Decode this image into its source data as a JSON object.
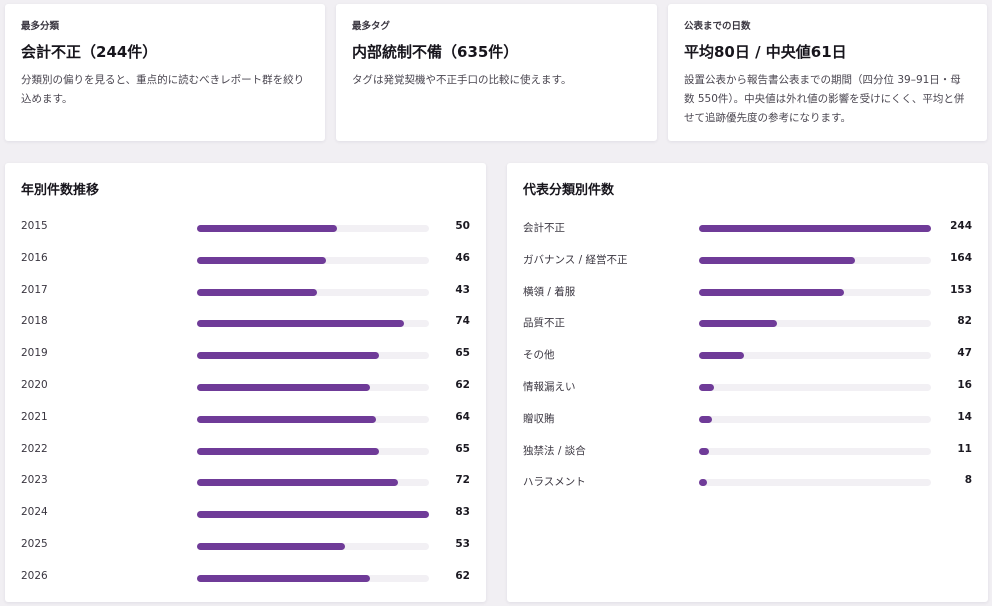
{
  "stats": [
    {
      "eyebrow": "最多分類",
      "value": "会計不正（244件）",
      "desc": "分類別の偏りを見ると、重点的に読むべきレポート群を絞り込めます。"
    },
    {
      "eyebrow": "最多タグ",
      "value": "内部統制不備（635件）",
      "desc": "タグは発覚契機や不正手口の比較に使えます。"
    },
    {
      "eyebrow": "公表までの日数",
      "value": "平均80日 / 中央値61日",
      "desc": "設置公表から報告書公表までの期間（四分位 39–91日・母数 550件）。中央値は外れ値の影響を受けにくく、平均と併せて追跡優先度の参考になります。"
    }
  ],
  "chart_data": [
    {
      "type": "bar",
      "title": "年別件数推移",
      "categories": [
        "2015",
        "2016",
        "2017",
        "2018",
        "2019",
        "2020",
        "2021",
        "2022",
        "2023",
        "2024",
        "2025",
        "2026"
      ],
      "values": [
        50,
        46,
        43,
        74,
        65,
        62,
        64,
        65,
        72,
        83,
        53,
        62
      ],
      "ylim": [
        0,
        83
      ],
      "colors": {
        "bar": "#6f3b98",
        "track": "#f2f0f4"
      }
    },
    {
      "type": "bar",
      "title": "代表分類別件数",
      "categories": [
        "会計不正",
        "ガバナンス / 経営不正",
        "横領 / 着服",
        "品質不正",
        "その他",
        "情報漏えい",
        "贈収賄",
        "独禁法 / 談合",
        "ハラスメント"
      ],
      "values": [
        244,
        164,
        153,
        82,
        47,
        16,
        14,
        11,
        8
      ],
      "ylim": [
        0,
        244
      ],
      "colors": {
        "bar": "#6f3b98",
        "track": "#f2f0f4"
      }
    }
  ]
}
